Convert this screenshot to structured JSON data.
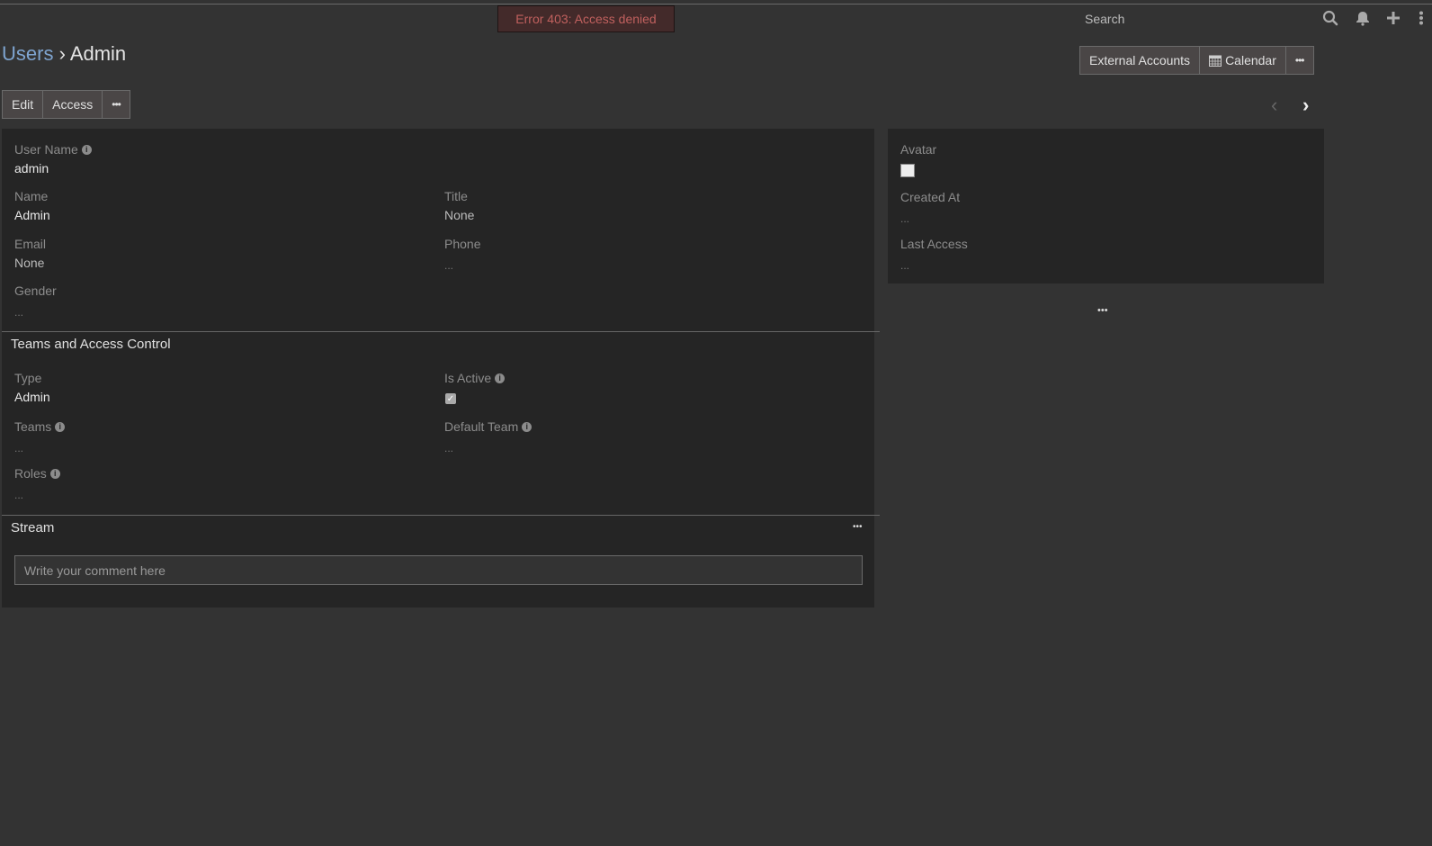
{
  "alert": {
    "text": "Error 403: Access denied",
    "color": "#c0605e"
  },
  "navbar": {
    "search_placeholder": "Search",
    "icons": [
      "search-icon",
      "bell-icon",
      "plus-icon",
      "menu-vertical-icon"
    ]
  },
  "breadcrumb": {
    "parent": "Users",
    "separator": "›",
    "current": "Admin"
  },
  "actions": {
    "edit": "Edit",
    "access": "Access",
    "more": "•••"
  },
  "header_buttons": {
    "external_accounts": "External Accounts",
    "calendar": "Calendar",
    "more": "•••"
  },
  "overview": {
    "user_name": {
      "label": "User Name",
      "value": "admin"
    },
    "name": {
      "label": "Name",
      "value": "Admin"
    },
    "title": {
      "label": "Title",
      "value": "None"
    },
    "email": {
      "label": "Email",
      "value": "None"
    },
    "phone": {
      "label": "Phone",
      "value": "..."
    },
    "gender": {
      "label": "Gender",
      "value": "..."
    }
  },
  "teams_section": {
    "title": "Teams and Access Control",
    "type": {
      "label": "Type",
      "value": "Admin"
    },
    "is_active": {
      "label": "Is Active",
      "checked": true
    },
    "teams": {
      "label": "Teams",
      "value": "..."
    },
    "default_team": {
      "label": "Default Team",
      "value": "..."
    },
    "roles": {
      "label": "Roles",
      "value": "..."
    }
  },
  "stream": {
    "title": "Stream",
    "more": "•••",
    "comment_placeholder": "Write your comment here"
  },
  "side": {
    "avatar": {
      "label": "Avatar"
    },
    "created_at": {
      "label": "Created At",
      "value": "..."
    },
    "last_access": {
      "label": "Last Access",
      "value": "..."
    },
    "more": "•••"
  }
}
